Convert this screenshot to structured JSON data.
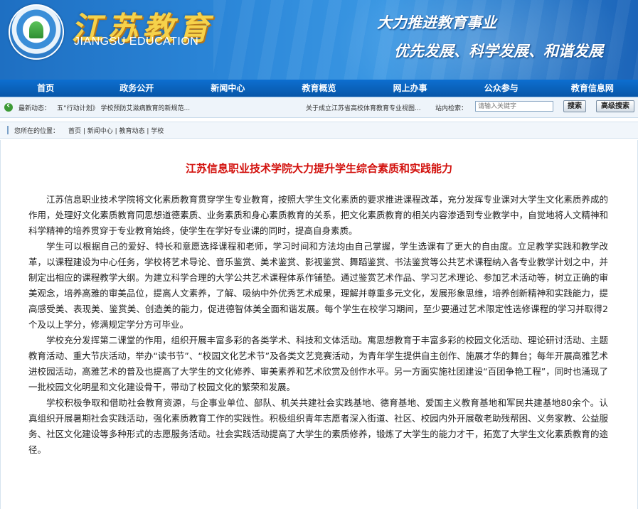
{
  "banner": {
    "site_name_cn": "江苏教育",
    "site_name_en": "JIANGSU EDUCATION",
    "slogan_line1": "大力推进教育事业",
    "slogan_line2": "优先发展、科学发展、和谐发展"
  },
  "nav": {
    "items": [
      "首页",
      "政务公开",
      "新闻中心",
      "教育概览",
      "网上办事",
      "公众参与",
      "教育信息网"
    ]
  },
  "infobar": {
    "latest_label": "最新动态：",
    "latest_text": "五”行动计划》 学校预防艾滋病教育的新规范...",
    "marquee2": "关于成立江苏省高校体育教育专业视图...",
    "search_label": "站内检索：",
    "search_placeholder": "请输入关键字",
    "search_button": "搜索",
    "advanced_button": "高级搜索"
  },
  "breadcrumb": {
    "label": "您所在的位置：",
    "path": "首页 | 新闻中心 | 教育动态 | 学校"
  },
  "article": {
    "title": "江苏信息职业技术学院大力提升学生综合素质和实践能力",
    "paragraphs": [
      "江苏信息职业技术学院将文化素质教育贯穿学生专业教育，按照大学生文化素质的要求推进课程改革，充分发挥专业课对大学生文化素质养成的作用，处理好文化素质教育同思想道德素质、业务素质和身心素质教育的关系，把文化素质教育的相关内容渗透到专业教学中，自觉地将人文精神和科学精神的培养贯穿于专业教育始终，使学生在学好专业课的同时，提高自身素质。",
      "学生可以根据自己的爱好、特长和意愿选择课程和老师，学习时间和方法均由自己掌握，学生选课有了更大的自由度。立足教学实践和教学改革，以课程建设为中心任务，学校将艺术导论、音乐鉴赏、美术鉴赏、影视鉴赏、舞蹈鉴赏、书法鉴赏等公共艺术课程纳入各专业教学计划之中，并制定出相应的课程教学大纲。为建立科学合理的大学公共艺术课程体系作铺垫。通过鉴赏艺术作品、学习艺术理论、参加艺术活动等，树立正确的审美观念，培养高雅的审美品位，提高人文素养，了解、吸纳中外优秀艺术成果，理解并尊重多元文化，发展形象思维，培养创新精神和实践能力，提高感受美、表现美、鉴赏美、创造美的能力，促进德智体美全面和谐发展。每个学生在校学习期间，至少要通过艺术限定性选修课程的学习并取得2个及以上学分，修满规定学分方可毕业。",
      "学校充分发挥第二课堂的作用，组织开展丰富多彩的各类学术、科技和文体活动。寓思想教育于丰富多彩的校园文化活动、理论研讨活动、主题教育活动、重大节庆活动，举办“读书节”、“校园文化艺术节”及各类文艺竞赛活动，为青年学生提供自主创作、施展才华的舞台；每年开展高雅艺术进校园活动，高雅艺术的普及也提高了大学生的文化修养、审美素养和艺术欣赏及创作水平。另一方面实施社团建设“百团争艳工程”，同时也涌现了一批校园文化明星和文化建设骨干，带动了校园文化的繁荣和发展。",
      "学校积极争取和借助社会教育资源，与企事业单位、部队、机关共建社会实践基地、德育基地、爱国主义教育基地和军民共建基地80余个。认真组织开展暑期社会实践活动，强化素质教育工作的实践性。积极组织青年志愿者深入街道、社区、校园内外开展敬老助残帮困、义务家教、公益服务、社区文化建设等多种形式的志愿服务活动。社会实践活动提高了大学生的素质修养，锻炼了大学生的能力才干，拓宽了大学生文化素质教育的途径。"
    ]
  }
}
